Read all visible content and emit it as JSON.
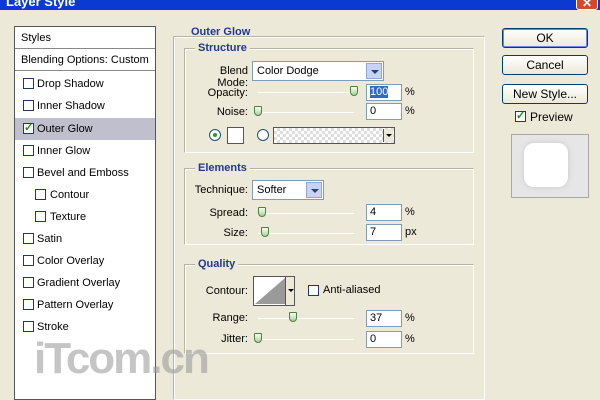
{
  "window": {
    "title": "Layer Style"
  },
  "styles_list": {
    "header": "Styles",
    "blending_options": "Blending Options: Custom",
    "items": [
      {
        "label": "Drop Shadow",
        "checked": false
      },
      {
        "label": "Inner Shadow",
        "checked": false
      },
      {
        "label": "Outer Glow",
        "checked": true
      },
      {
        "label": "Inner Glow",
        "checked": false
      },
      {
        "label": "Bevel and Emboss",
        "checked": false
      },
      {
        "label": "Contour",
        "checked": false
      },
      {
        "label": "Texture",
        "checked": false
      },
      {
        "label": "Satin",
        "checked": false
      },
      {
        "label": "Color Overlay",
        "checked": false
      },
      {
        "label": "Gradient Overlay",
        "checked": false
      },
      {
        "label": "Pattern Overlay",
        "checked": false
      },
      {
        "label": "Stroke",
        "checked": false
      }
    ]
  },
  "outer_glow": {
    "title": "Outer Glow",
    "structure": {
      "title": "Structure",
      "blend_mode_label": "Blend Mode:",
      "blend_mode_value": "Color Dodge",
      "opacity_label": "Opacity:",
      "opacity_value": "100",
      "noise_label": "Noise:",
      "noise_value": "0",
      "percent": "%"
    },
    "elements": {
      "title": "Elements",
      "technique_label": "Technique:",
      "technique_value": "Softer",
      "spread_label": "Spread:",
      "spread_value": "4",
      "size_label": "Size:",
      "size_value": "7",
      "percent": "%",
      "px": "px"
    },
    "quality": {
      "title": "Quality",
      "contour_label": "Contour:",
      "anti_aliased_label": "Anti-aliased",
      "range_label": "Range:",
      "range_value": "37",
      "jitter_label": "Jitter:",
      "jitter_value": "0",
      "percent": "%"
    }
  },
  "buttons": {
    "ok": "OK",
    "cancel": "Cancel",
    "new_style": "New Style...",
    "preview_label": "Preview"
  },
  "watermark": "iTcom.cn",
  "colors": {
    "title_bar": "#0a3ad0",
    "section_title": "#1f3a8a",
    "selected_row": "#c0bfce"
  }
}
